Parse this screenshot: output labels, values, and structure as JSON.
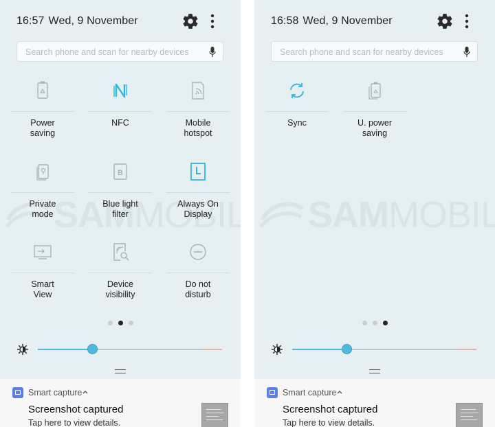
{
  "panels": [
    {
      "status": {
        "time": "16:57",
        "date": "Wed, 9 November"
      },
      "search": {
        "placeholder": "Search phone and scan for nearby devices"
      },
      "tiles": [
        {
          "label": "Power\nsaving",
          "icon": "power-saving-icon",
          "active": false
        },
        {
          "label": "NFC",
          "icon": "nfc-icon",
          "active": true
        },
        {
          "label": "Mobile\nhotspot",
          "icon": "mobile-hotspot-icon",
          "active": false
        },
        {
          "label": "Private\nmode",
          "icon": "private-mode-icon",
          "active": false
        },
        {
          "label": "Blue light\nfilter",
          "icon": "blue-light-filter-icon",
          "active": false
        },
        {
          "label": "Always On\nDisplay",
          "icon": "always-on-display-icon",
          "active": true
        },
        {
          "label": "Smart\nView",
          "icon": "smart-view-icon",
          "active": false
        },
        {
          "label": "Device\nvisibility",
          "icon": "device-visibility-icon",
          "active": false
        },
        {
          "label": "Do not\ndisturb",
          "icon": "do-not-disturb-icon",
          "active": false
        }
      ],
      "page_indicator": {
        "count": 3,
        "active": 2
      },
      "brightness": {
        "level": 0.33
      },
      "notification": {
        "app": "Smart capture",
        "title": "Screenshot captured",
        "subtitle": "Tap here to view details."
      },
      "watermark": {
        "bold": "SAM",
        "thin": "MOBILE"
      }
    },
    {
      "status": {
        "time": "16:58",
        "date": "Wed, 9 November"
      },
      "search": {
        "placeholder": "Search phone and scan for nearby devices"
      },
      "tiles": [
        {
          "label": "Sync",
          "icon": "sync-icon",
          "active": true
        },
        {
          "label": "U. power\nsaving",
          "icon": "ultra-power-saving-icon",
          "active": false
        }
      ],
      "page_indicator": {
        "count": 3,
        "active": 3
      },
      "brightness": {
        "level": 0.33
      },
      "notification": {
        "app": "Smart capture",
        "title": "Screenshot captured",
        "subtitle": "Tap here to view details."
      },
      "watermark": {
        "bold": "SAM",
        "thin": "MOBILE"
      }
    }
  ],
  "colors": {
    "active_icon": "#2bb6e0",
    "inactive_icon": "#a9b3b6",
    "panel_bg": "#e6f0f3",
    "accent": "#4fb8db"
  }
}
